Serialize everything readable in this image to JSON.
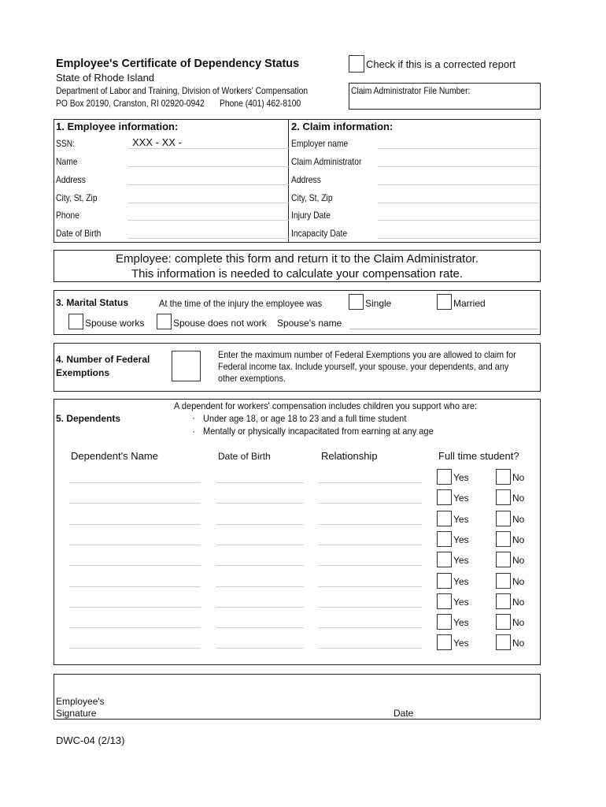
{
  "header": {
    "title": "Employee's Certificate of Dependency Status",
    "state": "State of Rhode Island",
    "department": "Department of Labor and Training, Division of Workers' Compensation",
    "address": "PO Box 20190, Cranston, RI  02920-0942",
    "phone": "Phone (401) 462-8100",
    "corrected_label": "Check if this is a corrected report",
    "file_number_label": "Claim Administrator File Number:",
    "file_number_value": ""
  },
  "section1": {
    "title": "1.  Employee information:",
    "fields": [
      {
        "label": "SSN:",
        "value": "XXX - XX -"
      },
      {
        "label": "Name",
        "value": ""
      },
      {
        "label": "Address",
        "value": ""
      },
      {
        "label": "City, St, Zip",
        "value": ""
      },
      {
        "label": "Phone",
        "value": ""
      },
      {
        "label": "Date of Birth",
        "value": ""
      }
    ]
  },
  "section2": {
    "title": "2.  Claim information:",
    "fields": [
      {
        "label": "Employer name",
        "value": ""
      },
      {
        "label": "Claim Administrator",
        "value": ""
      },
      {
        "label": "Address",
        "value": ""
      },
      {
        "label": "City, St, Zip",
        "value": ""
      },
      {
        "label": "Injury Date",
        "value": ""
      },
      {
        "label": "Incapacity Date",
        "value": ""
      }
    ]
  },
  "notice": {
    "line1": "Employee:  complete this form and return it to the Claim Administrator.",
    "line2": "This information is needed to calculate your compensation rate."
  },
  "section3": {
    "title": "3.  Marital Status",
    "prompt": "At the time of the injury the employee was",
    "single_label": "Single",
    "married_label": "Married",
    "spouse_works_label": "Spouse works",
    "spouse_not_work_label": "Spouse does not work",
    "spouse_name_label": "Spouse's name",
    "spouse_name_value": ""
  },
  "section4": {
    "title_line1": "4.  Number of Federal",
    "title_line2": "Exemptions",
    "value": "",
    "desc_line1": "Enter the maximum number of Federal Exemptions you are allowed to claim for",
    "desc_line2": "Federal income tax.  Include yourself, your spouse, your dependents, and any",
    "desc_line3": "other exemptions."
  },
  "section5": {
    "title": "5.  Dependents",
    "intro": "A dependent for workers' compensation includes children you support who are:",
    "bullet_char": "·",
    "bullets": [
      "Under age 18, or age 18 to 23 and a full time student",
      "Mentally or physically incapacitated from earning at any age"
    ],
    "columns": {
      "name": "Dependent's Name",
      "dob": "Date of Birth",
      "relationship": "Relationship",
      "student": "Full time student?"
    },
    "yes_label": "Yes",
    "no_label": "No",
    "rows": [
      {
        "name": "",
        "dob": "",
        "relationship": ""
      },
      {
        "name": "",
        "dob": "",
        "relationship": ""
      },
      {
        "name": "",
        "dob": "",
        "relationship": ""
      },
      {
        "name": "",
        "dob": "",
        "relationship": ""
      },
      {
        "name": "",
        "dob": "",
        "relationship": ""
      },
      {
        "name": "",
        "dob": "",
        "relationship": ""
      },
      {
        "name": "",
        "dob": "",
        "relationship": ""
      },
      {
        "name": "",
        "dob": "",
        "relationship": ""
      },
      {
        "name": "",
        "dob": "",
        "relationship": ""
      }
    ]
  },
  "signature": {
    "label_line1": "Employee's",
    "label_line2": "Signature",
    "date_label": "Date"
  },
  "footer": {
    "form_id": "DWC-04 (2/13)"
  }
}
